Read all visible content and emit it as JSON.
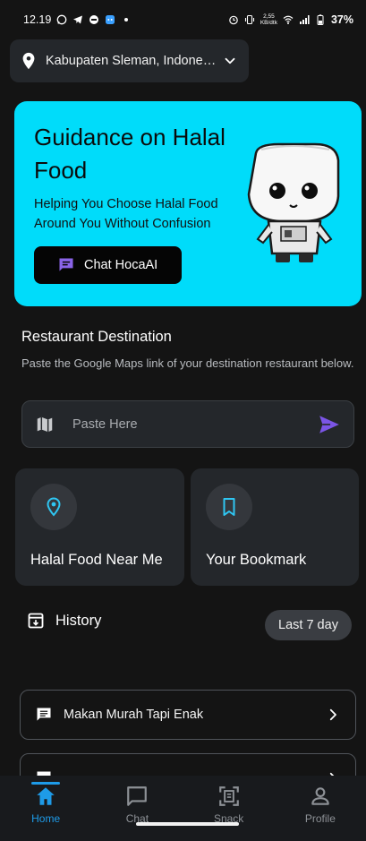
{
  "status_bar": {
    "time": "12.19",
    "net_speed_value": "2,55",
    "net_speed_unit": "KB/dtk",
    "battery": "37%"
  },
  "location": {
    "text": "Kabupaten Sleman, Indone…"
  },
  "hero": {
    "title": "Guidance on Halal Food",
    "subtitle": "Helping You Choose Halal Food Around You Without Confusion",
    "cta_label": "Chat HocaAI"
  },
  "destination": {
    "title": "Restaurant Destination",
    "description": "Paste the Google Maps link of your destination restaurant below.",
    "input_placeholder": "Paste Here"
  },
  "tiles": [
    {
      "label": "Halal Food Near Me",
      "icon": "location-pin-icon"
    },
    {
      "label": "Your Bookmark",
      "icon": "bookmark-icon"
    }
  ],
  "history": {
    "title": "History",
    "filter_label": "Last 7 day",
    "items": [
      {
        "title": "Makan Murah Tapi Enak"
      },
      {
        "title": ""
      }
    ]
  },
  "bottom_nav": [
    {
      "label": "Home",
      "icon": "home-icon",
      "active": true
    },
    {
      "label": "Chat",
      "icon": "chat-icon",
      "active": false
    },
    {
      "label": "Snack",
      "icon": "scan-icon",
      "active": false
    },
    {
      "label": "Profile",
      "icon": "profile-icon",
      "active": false
    }
  ],
  "colors": {
    "background": "#141414",
    "hero_bg": "#00dcfa",
    "accent": "#1e9be8",
    "send": "#7b55e6",
    "chat_icon": "#8a64e8"
  }
}
